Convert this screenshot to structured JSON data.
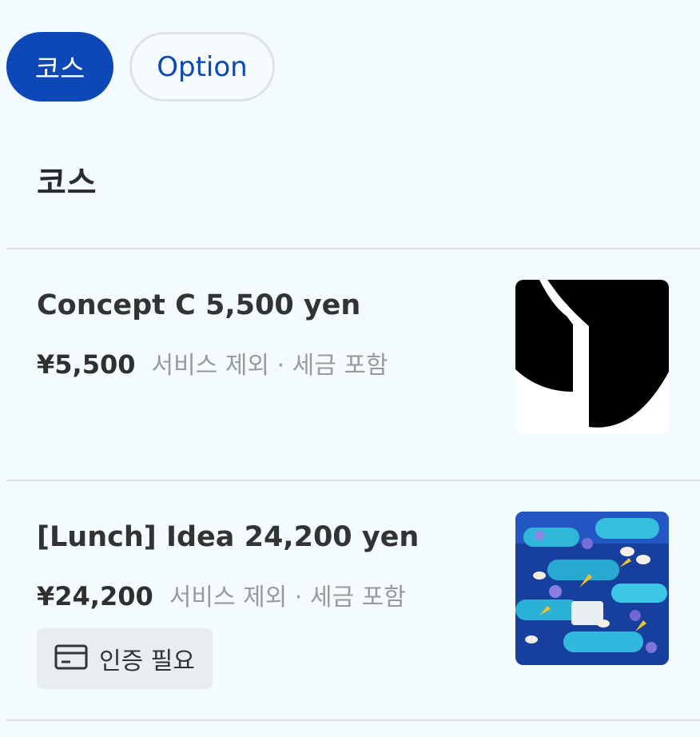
{
  "tabs": [
    {
      "label": "코스",
      "active": true
    },
    {
      "label": "Option",
      "active": false
    }
  ],
  "section": {
    "title": "코스"
  },
  "items": [
    {
      "name": "Concept C 5,500 yen",
      "price": "¥5,500",
      "note": "서비스 제외 · 세금 포함",
      "image": "logo-thumbnail"
    },
    {
      "name": "[Lunch] Idea 24,200 yen",
      "price": "¥24,200",
      "note": "서비스 제외 · 세금 포함",
      "image": "food-photo-thumbnail",
      "badge": {
        "icon": "credit-card-icon",
        "label": "인증 필요"
      }
    }
  ],
  "colors": {
    "background": "#f4fbff",
    "accent": "#0c48b6",
    "muted_text": "#9a9a9a",
    "badge_bg": "#e8edf1"
  }
}
